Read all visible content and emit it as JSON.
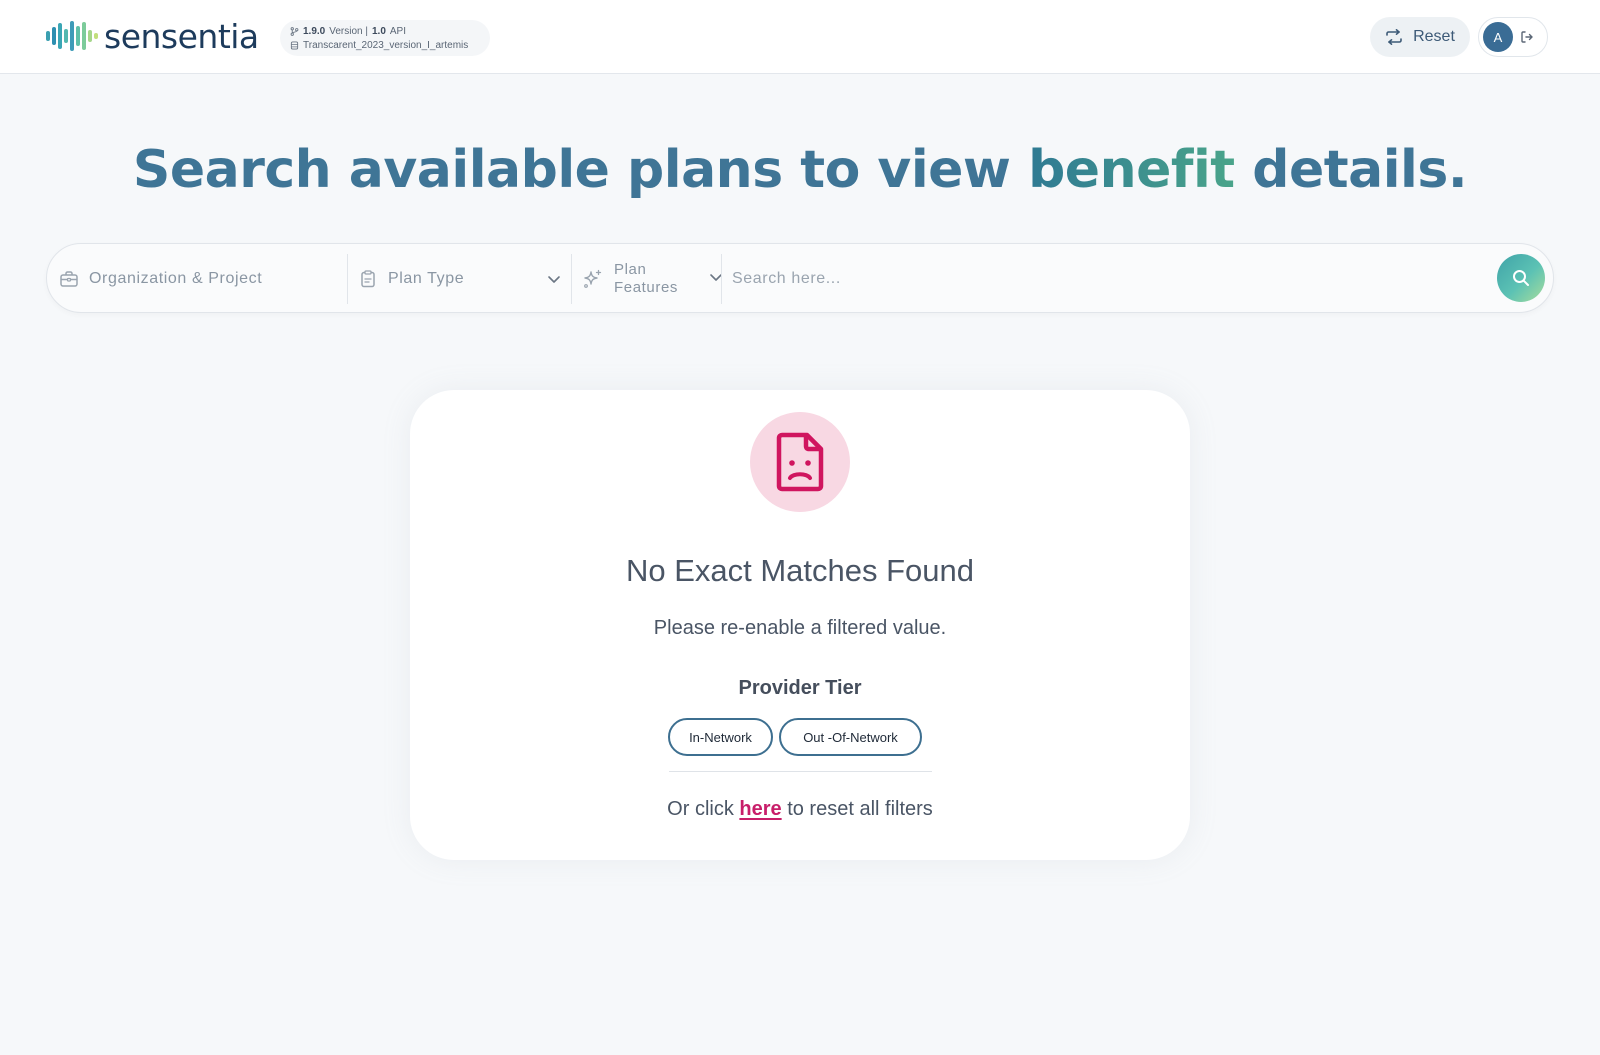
{
  "header": {
    "brand_name": "sensentia",
    "version_number": "1.9.0",
    "version_word": "Version |",
    "api_number": "1.0",
    "api_word": "API",
    "database_name": "Transcarent_2023_version_I_artemis",
    "reset_label": "Reset",
    "avatar_initial": "A",
    "icons": {
      "branch": "git-branch-icon",
      "database": "database-icon",
      "reset": "refresh-icon",
      "logout": "logout-icon"
    }
  },
  "hero": {
    "title_before": "Search available plans to view ",
    "title_accent": "benefit",
    "title_after": " details."
  },
  "search": {
    "organization_label": "Organization & Project",
    "plan_type_label": "Plan Type",
    "plan_features_line1": "Plan",
    "plan_features_line2": "Features",
    "placeholder": "Search here...",
    "icons": {
      "organization": "briefcase-icon",
      "plan_type": "clipboard-icon",
      "plan_features": "sparkle-icon",
      "submit": "search-icon"
    }
  },
  "empty_state": {
    "icon": "sad-document-icon",
    "title": "No Exact Matches Found",
    "subtitle": "Please re-enable a filtered value.",
    "filter_group_label": "Provider Tier",
    "chips": [
      "In-Network",
      "Out -Of-Network"
    ],
    "reset_prefix": "Or click ",
    "reset_link": "here",
    "reset_suffix": " to reset all filters"
  },
  "colors": {
    "brand_teal": "#3f7596",
    "accent_pink": "#c81e6a",
    "chip_border": "#3d6f90"
  }
}
